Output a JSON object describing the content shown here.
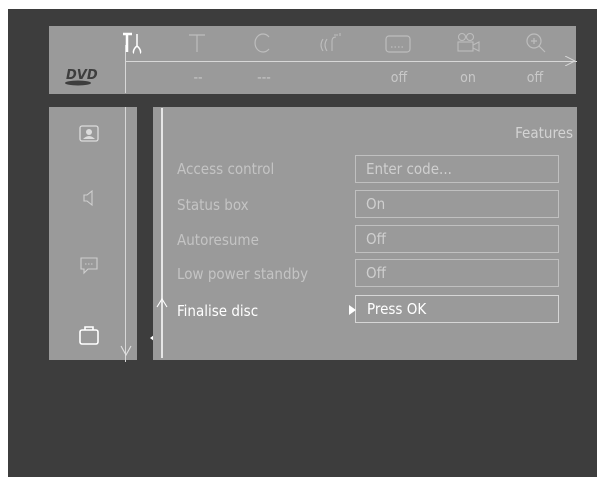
{
  "toolbar": {
    "icons": [
      "settings-tools-icon",
      "title-icon",
      "chapter-icon",
      "audio-icon",
      "subtitle-icon",
      "angle-camera-icon",
      "zoom-icon"
    ]
  },
  "status": {
    "logo": "DVD",
    "values": [
      "--",
      "---",
      "off",
      "on",
      "off"
    ]
  },
  "left_menu": {
    "icons": [
      "user-preferences-icon",
      "audio-settings-icon",
      "language-icon",
      "features-icon"
    ]
  },
  "features": {
    "title": "Features",
    "rows": [
      {
        "label": "Access control",
        "value": "Enter code..."
      },
      {
        "label": "Status box",
        "value": "On"
      },
      {
        "label": "Autoresume",
        "value": "Off"
      },
      {
        "label": "Low power standby",
        "value": "Off"
      },
      {
        "label": "Finalise disc",
        "value": "Press OK"
      }
    ]
  },
  "colors": {
    "panel": "#9a9a9a",
    "background": "#3d3d3d",
    "frame": "#ffffff",
    "active_text": "#ffffff"
  }
}
